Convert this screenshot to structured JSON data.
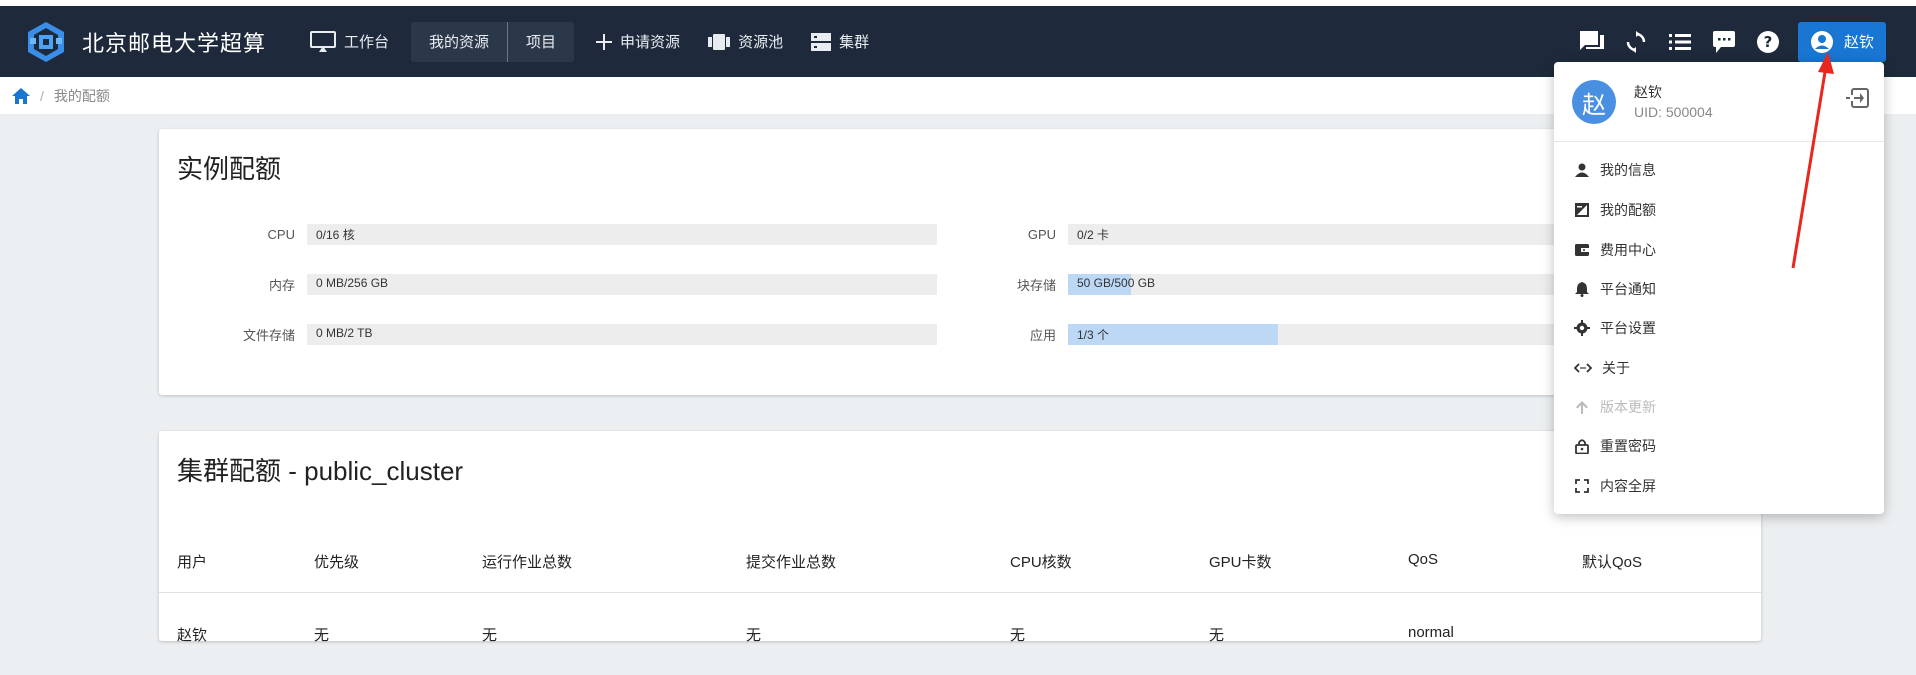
{
  "app": {
    "title": "北京邮电大学超算"
  },
  "nav": {
    "items": [
      {
        "label": "工作台",
        "icon": "monitor-icon"
      },
      {
        "label": "我的资源"
      },
      {
        "label": "项目"
      },
      {
        "label": "申请资源",
        "icon": "plus-icon"
      },
      {
        "label": "资源池",
        "icon": "pool-icon"
      },
      {
        "label": "集群",
        "icon": "server-icon"
      }
    ]
  },
  "user": {
    "name": "赵钦",
    "avatar_char": "赵",
    "uid": "UID: 500004"
  },
  "breadcrumb": {
    "current": "我的配额"
  },
  "instance_quota": {
    "title": "实例配额",
    "rows": [
      {
        "label": "CPU",
        "text": "0/16 核",
        "used": 0,
        "total": 16
      },
      {
        "label": "GPU",
        "text": "0/2 卡",
        "used": 0,
        "total": 2
      },
      {
        "label": "内存",
        "text": "0 MB/256 GB",
        "used": 0,
        "total": 256
      },
      {
        "label": "块存储",
        "text": "50 GB/500 GB",
        "used": 50,
        "total": 500
      },
      {
        "label": "文件存储",
        "text": "0 MB/2 TB",
        "used": 0,
        "total": 2
      },
      {
        "label": "应用",
        "text": "1/3 个",
        "used": 1,
        "total": 3
      }
    ]
  },
  "cluster_quota": {
    "title": "集群配额 - public_cluster",
    "columns": [
      "用户",
      "优先级",
      "运行作业总数",
      "提交作业总数",
      "CPU核数",
      "GPU卡数",
      "QoS",
      "默认QoS"
    ],
    "rows": [
      [
        "赵钦",
        "无",
        "无",
        "无",
        "无",
        "无",
        "normal",
        ""
      ]
    ]
  },
  "user_menu": {
    "items": [
      {
        "label": "我的信息",
        "icon": "person-icon",
        "enabled": true
      },
      {
        "label": "我的配额",
        "icon": "quota-icon",
        "enabled": true
      },
      {
        "label": "费用中心",
        "icon": "wallet-icon",
        "enabled": true
      },
      {
        "label": "平台通知",
        "icon": "bell-icon",
        "enabled": true
      },
      {
        "label": "平台设置",
        "icon": "gear-icon",
        "enabled": true
      },
      {
        "label": "关于",
        "icon": "code-icon",
        "enabled": true
      },
      {
        "label": "版本更新",
        "icon": "arrow-up-icon",
        "enabled": false
      },
      {
        "label": "重置密码",
        "icon": "lock-icon",
        "enabled": true
      },
      {
        "label": "内容全屏",
        "icon": "fullscreen-icon",
        "enabled": true
      }
    ]
  },
  "colors": {
    "topbar": "#1e2a3b",
    "accent": "#1976d2",
    "bar_fill": "#bcd8f5",
    "annotation_arrow": "#e8271e"
  }
}
